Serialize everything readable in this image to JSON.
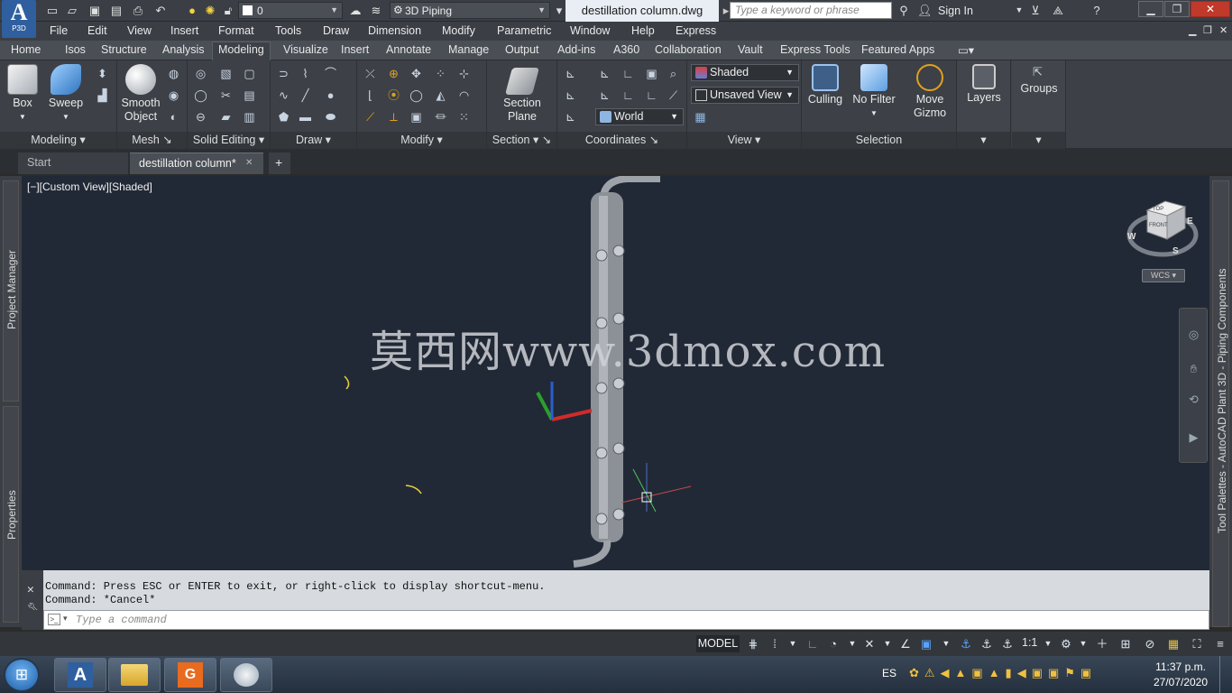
{
  "app": {
    "logo_text": "A",
    "logo_sub": "P3D",
    "workspace": "3D Piping",
    "document_title": "destillation column.dwg",
    "search_placeholder": "Type a keyword or phrase",
    "sign_in": "Sign In",
    "layer_value": "0"
  },
  "menu": [
    "File",
    "Edit",
    "View",
    "Insert",
    "Format",
    "Tools",
    "Draw",
    "Dimension",
    "Modify",
    "Parametric",
    "Window",
    "Help",
    "Express"
  ],
  "ribbon_tabs": [
    "Home",
    "Isos",
    "Structure",
    "Analysis",
    "Modeling",
    "Visualize",
    "Insert",
    "Annotate",
    "Manage",
    "Output",
    "Add-ins",
    "A360",
    "Collaboration",
    "Vault",
    "Express Tools",
    "Featured Apps"
  ],
  "active_tab": "Modeling",
  "panels": {
    "modeling": {
      "title": "Modeling",
      "box": "Box",
      "sweep": "Sweep"
    },
    "mesh": {
      "title": "Mesh",
      "smooth": "Smooth",
      "object": "Object"
    },
    "solid_editing": {
      "title": "Solid Editing"
    },
    "draw": {
      "title": "Draw"
    },
    "modify": {
      "title": "Modify"
    },
    "section": {
      "title": "Section",
      "btn1": "Section",
      "btn2": "Plane"
    },
    "coordinates": {
      "title": "Coordinates",
      "world": "World"
    },
    "view": {
      "title": "View",
      "visual_style": "Shaded",
      "named_view": "Unsaved View"
    },
    "selection": {
      "title": "Selection",
      "culling": "Culling",
      "filter": "No Filter",
      "gizmo1": "Move",
      "gizmo2": "Gizmo"
    },
    "layers": {
      "title": "Layers"
    },
    "groups": {
      "title": "Groups"
    }
  },
  "doc_tabs": {
    "start": "Start",
    "active": "destillation column*",
    "close": "✕",
    "new": "+"
  },
  "viewport": {
    "label": "[−][Custom View][Shaded]",
    "watermark": "莫西网www.3dmox.com",
    "viewcube": {
      "top": "TOP",
      "front": "FRONT",
      "n": "W",
      "e": "E",
      "s": "S"
    },
    "wcs": "WCS"
  },
  "side_palettes": {
    "project_manager": "Project Manager",
    "properties": "Properties",
    "tool_palettes": "Tool Palettes - AutoCAD Plant 3D - Piping Components"
  },
  "command": {
    "line1": "Command: Press ESC or ENTER to exit, or right-click to display shortcut-menu.",
    "line2": "Command: *Cancel*",
    "placeholder": "Type a command"
  },
  "status": {
    "model": "MODEL",
    "scale": "1:1"
  },
  "taskbar": {
    "lang": "ES",
    "time": "11:37 p.m.",
    "date": "27/07/2020"
  }
}
